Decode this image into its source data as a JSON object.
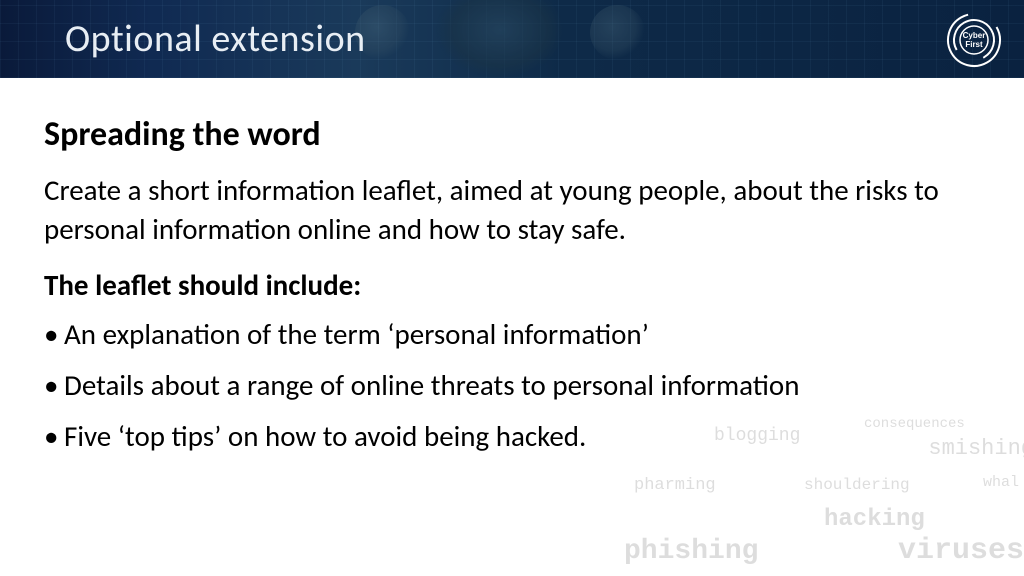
{
  "header": {
    "title": "Optional extension",
    "logo_text_top": "Cyber",
    "logo_text_bottom": "First"
  },
  "content": {
    "subtitle": "Spreading the word",
    "intro": "Create a short information leaflet, aimed at young people, about the risks to personal information online and how to stay safe.",
    "include_label": "The leaflet should include:",
    "bullets": [
      "An explanation of the term ‘personal information’",
      "Details about a range of online threats to personal information",
      "Five ‘top tips’ on how to avoid being hacked."
    ]
  },
  "watermark": {
    "words": [
      "blogging",
      "consequences",
      "smishing",
      "pharming",
      "shouldering",
      "whal",
      "hacking",
      "phishing",
      "viruses"
    ]
  }
}
